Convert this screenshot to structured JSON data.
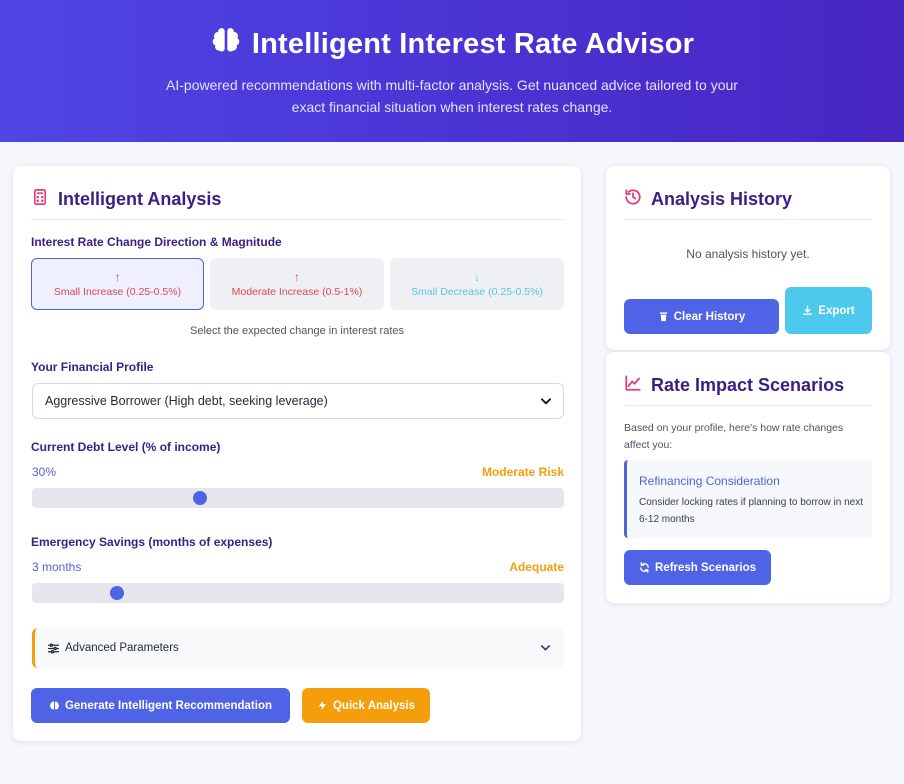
{
  "header": {
    "title": "Intelligent Interest Rate Advisor",
    "subtitle": "AI-powered recommendations with multi-factor analysis. Get nuanced advice tailored to your exact financial situation when interest rates change."
  },
  "analysis": {
    "title": "Intelligent Analysis",
    "direction_label": "Interest Rate Change Direction & Magnitude",
    "directions": [
      {
        "label": "Small Increase (0.25-0.5%)",
        "arrow": "↑",
        "active": true
      },
      {
        "label": "Moderate Increase (0.5-1%)",
        "arrow": "↑",
        "active": false
      },
      {
        "label": "Small Decrease (0.25-0.5%)",
        "arrow": "↓",
        "active": false
      }
    ],
    "direction_hint": "Select the expected change in interest rates",
    "profile_label": "Your Financial Profile",
    "profile_value": "Aggressive Borrower (High debt, seeking leverage)",
    "debt_label": "Current Debt Level (% of income)",
    "debt_value": "30%",
    "debt_risk": "Moderate Risk",
    "debt_level": 0.31,
    "savings_label": "Emergency Savings (months of expenses)",
    "savings_value": "3 months",
    "savings_status": "Adequate",
    "savings_level": 0.15,
    "advanced_label": "Advanced Parameters",
    "generate_label": "Generate Intelligent Recommendation",
    "quick_label": "Quick Analysis"
  },
  "history": {
    "title": "Analysis History",
    "empty_text": "No analysis history yet.",
    "clear_label": "Clear History",
    "export_label": "Export"
  },
  "scenarios": {
    "title": "Rate Impact Scenarios",
    "intro": "Based on your profile, here's how rate changes affect you:",
    "item_title": "Refinancing Consideration",
    "item_desc": "Consider locking rates if planning to borrow in next 6-12 months",
    "refresh_label": "Refresh Scenarios"
  },
  "colors": {
    "primary": "#4f63e6",
    "accent_orange": "#f59e0b",
    "accent_cyan": "#4cc9ec",
    "heading": "#3b1d86",
    "icon_pink": "#e23f7a"
  }
}
